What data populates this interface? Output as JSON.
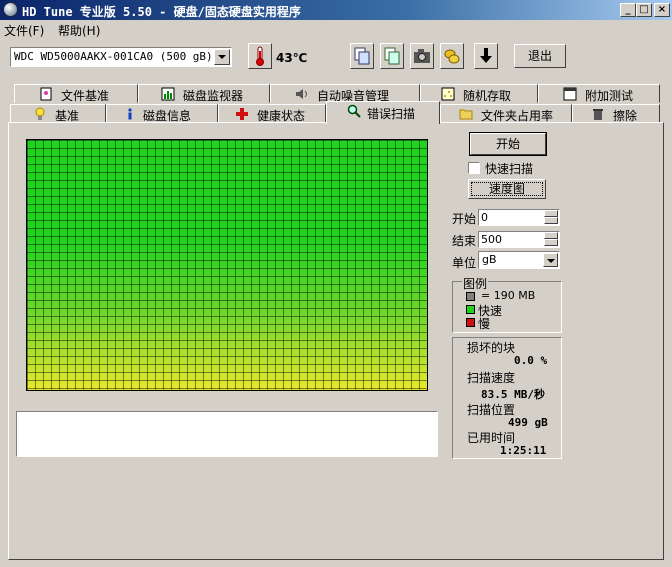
{
  "window": {
    "title": "HD Tune 专业版 5.50 - 硬盘/固态硬盘实用程序"
  },
  "menu": {
    "items": [
      "文件(F)",
      "帮助(H)"
    ]
  },
  "toolbar": {
    "drive": "WDC WD5000AAKX-001CA0 (500 gB)",
    "temperature": "43℃",
    "exit_label": "退出",
    "icons": [
      "copy-icon",
      "copy-settings-icon",
      "camera-icon",
      "coins-icon",
      "save-arrow-icon"
    ]
  },
  "tabs": {
    "row1": [
      "文件基准",
      "磁盘监视器",
      "自动噪音管理",
      "随机存取",
      "附加测试"
    ],
    "row2": [
      "基准",
      "磁盘信息",
      "健康状态",
      "错误扫描",
      "文件夹占用率",
      "擦除"
    ],
    "active": "错误扫描"
  },
  "controls": {
    "start_button": "开始",
    "quick_scan_label": "快速扫描",
    "quick_scan_checked": false,
    "speed_map_button": "速度图",
    "start_label": "开始",
    "start_value": "0",
    "end_label": "结束",
    "end_value": "500",
    "unit_label": "单位",
    "unit_value": "gB"
  },
  "legend": {
    "title": "图例",
    "block_size": "= 190 MB",
    "fast": "快速",
    "slow": "慢",
    "colors": {
      "block": "#808080",
      "fast": "#1fd31f",
      "slow": "#d01010"
    }
  },
  "stats": {
    "damaged_label": "损坏的块",
    "damaged_value": "0.0 %",
    "speed_label": "扫描速度",
    "speed_value": "83.5 MB/秒",
    "position_label": "扫描位置",
    "position_value": "499 gB",
    "elapsed_label": "已用时间",
    "elapsed_value": "1:25:11"
  },
  "scan_progress": 1.0
}
